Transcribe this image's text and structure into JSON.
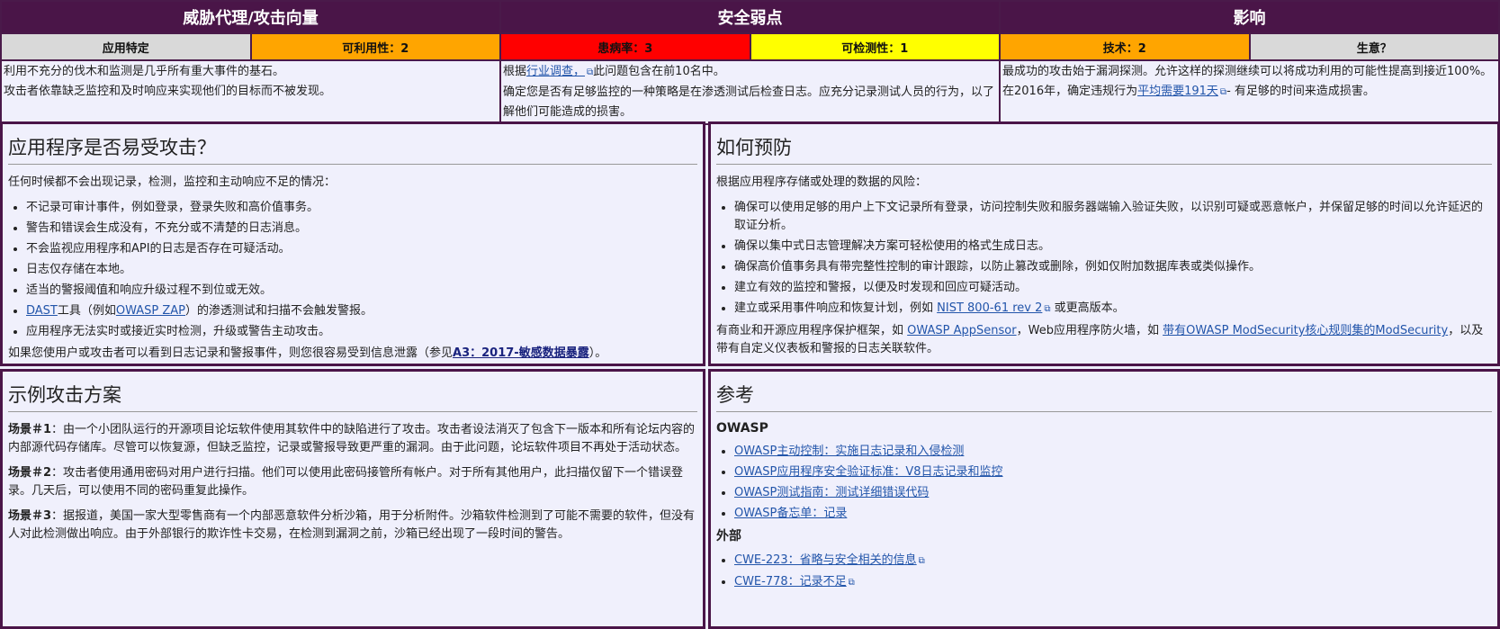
{
  "risk_table": {
    "headers": {
      "threat_agents": "威胁代理/攻击向量",
      "weakness": "安全弱点",
      "impacts": "影响"
    },
    "ratings": {
      "app_specific": "应用特定",
      "exploitability": "可利用性：2",
      "prevalence": "患病率：3",
      "detectability": "可检测性：1",
      "technical": "技术：2",
      "business": "生意？"
    },
    "col1": {
      "line1": "利用不充分的伐木和监测是几乎所有重大事件的基石。",
      "line2": "攻击者依靠缺乏监控和及时响应来实现他们的目标而不被发现。"
    },
    "col2": {
      "line1_pre": "根据",
      "line1_link": "行业调查，",
      "line1_post": "此问题包含在前10名中。",
      "line2": "确定您是否有足够监控的一种策略是在渗透测试后检查日志。应充分记录测试人员的行为，以了解他们可能造成的损害。"
    },
    "col3": {
      "line1": "最成功的攻击始于漏洞探测。允许这样的探测继续可以将成功利用的可能性提高到接近100%。",
      "line2_pre": "在2016年，确定违规行为",
      "line2_link": "平均需要191天",
      "line2_post": "- 有足够的时间来造成损害。"
    }
  },
  "vulnerable": {
    "title": "应用程序是否易受攻击？",
    "intro": "任何时候都不会出现记录，检测，监控和主动响应不足的情况：",
    "items": [
      "不记录可审计事件，例如登录，登录失败和高价值事务。",
      "警告和错误会生成没有，不充分或不清楚的日志消息。",
      "不会监视应用程序和API的日志是否存在可疑活动。",
      "日志仅存储在本地。",
      "适当的警报阈值和响应升级过程不到位或无效。"
    ],
    "dast_link": "DAST",
    "dast_mid": "工具（例如",
    "zap_link": "OWASP ZAP",
    "dast_post": "）的渗透测试和扫描不会触发警报。",
    "item_last": "应用程序无法实时或接近实时检测，升级或警告主动攻击。",
    "outro_pre": "如果您使用户或攻击者可以看到日志记录和警报事件，则您很容易受到信息泄露（参见",
    "outro_link": "A3：2017-敏感数据暴露",
    "outro_post": "）。"
  },
  "prevent": {
    "title": "如何预防",
    "intro": "根据应用程序存储或处理的数据的风险：",
    "items": [
      "确保可以使用足够的用户上下文记录所有登录，访问控制失败和服务器端输入验证失败，以识别可疑或恶意帐户，并保留足够的时间以允许延迟的取证分析。",
      "确保以集中式日志管理解决方案可轻松使用的格式生成日志。",
      "确保高价值事务具有带完整性控制的审计跟踪，以防止篡改或删除，例如仅附加数据库表或类似操作。",
      "建立有效的监控和警报，以便及时发现和回应可疑活动。"
    ],
    "nist_pre": "建立或采用事件响应和恢复计划，例如",
    "nist_link": "NIST 800-61 rev 2",
    "nist_post": "或更高版本。",
    "outro_pre": "有商业和开源应用程序保护框架，如",
    "appsensor_link": "OWASP AppSensor",
    "outro_mid": "，Web应用程序防火墙，如",
    "modsec_link": "带有OWASP ModSecurity核心规则集的ModSecurity",
    "outro_post": "，以及带有自定义仪表板和警报的日志关联软件。"
  },
  "scenarios": {
    "title": "示例攻击方案",
    "s1_label": "场景＃1",
    "s1_text": "：由一个小团队运行的开源项目论坛软件使用其软件中的缺陷进行了攻击。攻击者设法消灭了包含下一版本和所有论坛内容的内部源代码存储库。尽管可以恢复源，但缺乏监控，记录或警报导致更严重的漏洞。由于此问题，论坛软件项目不再处于活动状态。",
    "s2_label": "场景＃2",
    "s2_text": "：攻击者使用通用密码对用户进行扫描。他们可以使用此密码接管所有帐户。对于所有其他用户，此扫描仅留下一个错误登录。几天后，可以使用不同的密码重复此操作。",
    "s3_label": "场景＃3",
    "s3_text": "：据报道，美国一家大型零售商有一个内部恶意软件分析沙箱，用于分析附件。沙箱软件检测到了可能不需要的软件，但没有人对此检测做出响应。由于外部银行的欺诈性卡交易，在检测到漏洞之前，沙箱已经出现了一段时间的警告。"
  },
  "references": {
    "title": "参考",
    "owasp_heading": "OWASP",
    "owasp_links": [
      "OWASP主动控制：实施日志记录和入侵检测",
      "OWASP应用程序安全验证标准：V8日志记录和监控",
      "OWASP测试指南：测试详细错误代码",
      "OWASP备忘单：记录"
    ],
    "external_heading": "外部",
    "external_links": [
      "CWE-223：省略与安全相关的信息",
      "CWE-778：记录不足"
    ]
  }
}
